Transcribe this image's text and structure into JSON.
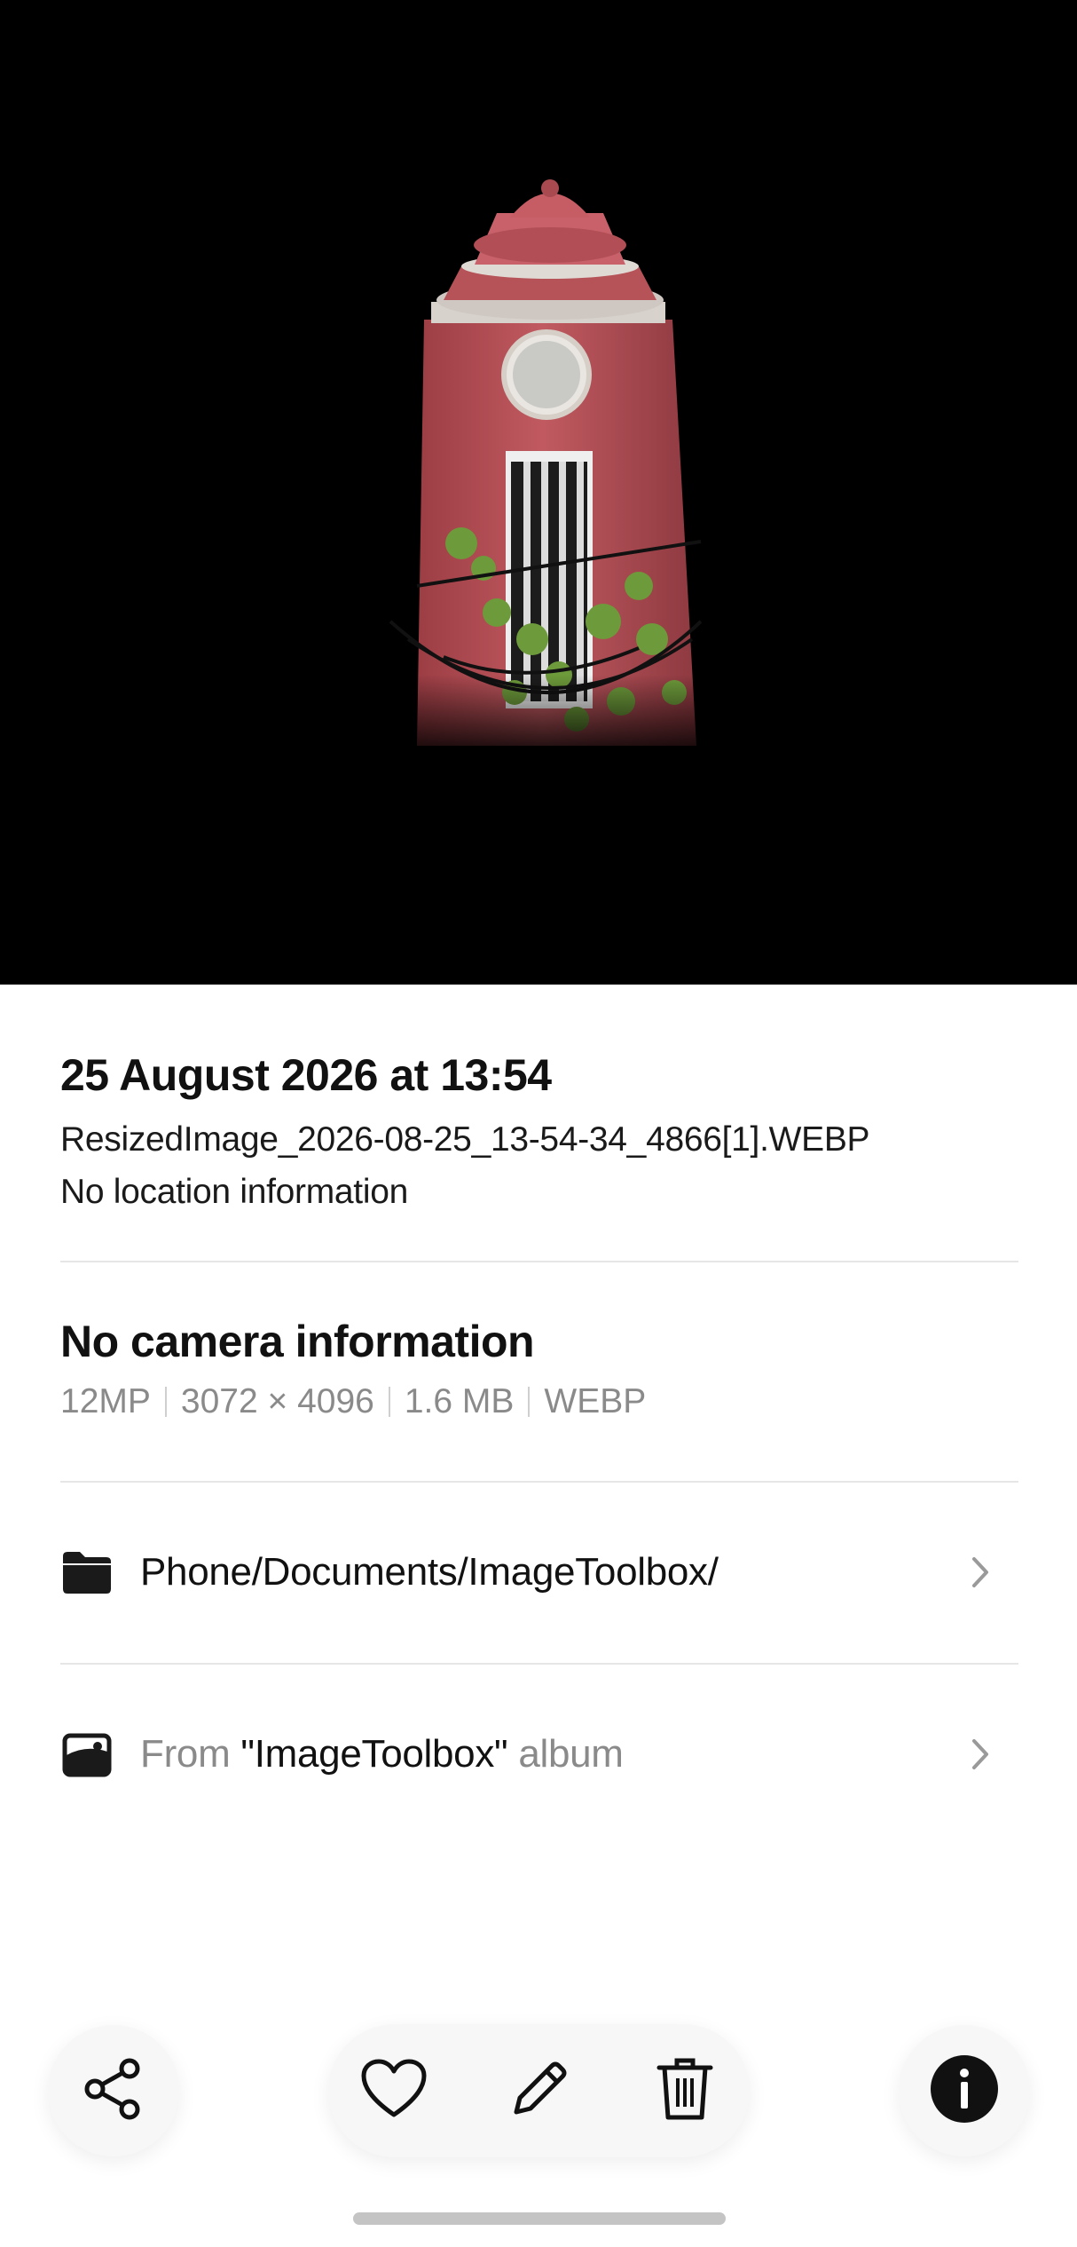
{
  "photo": {
    "subject": "red-brick-clock-tower-photo"
  },
  "details": {
    "date_time": "25 August 2026 at 13:54",
    "filename": "ResizedImage_2026-08-25_13-54-34_4866[1].WEBP",
    "location": "No location information"
  },
  "camera": {
    "title": "No camera information",
    "specs": [
      "12MP",
      "3072 × 4096",
      "1.6 MB",
      "WEBP"
    ]
  },
  "folder": {
    "icon": "folder-icon",
    "path": "Phone/Documents/ImageToolbox/"
  },
  "album": {
    "icon": "album-icon",
    "prefix": "From ",
    "name": "\"ImageToolbox\"",
    "suffix": " album"
  },
  "actions": {
    "share": "share-icon",
    "favorite": "heart-icon",
    "edit": "pencil-icon",
    "delete": "trash-icon",
    "info": "info-icon"
  },
  "colors": {
    "background": "#ffffff",
    "photo_background": "#000000",
    "brick": "#b94f55",
    "muted_text": "#8a8a8a"
  }
}
